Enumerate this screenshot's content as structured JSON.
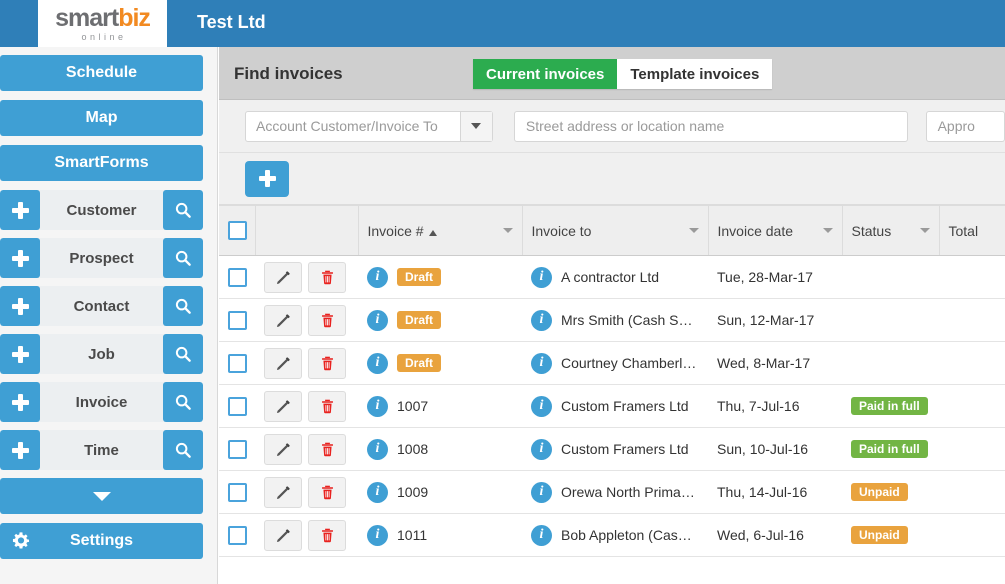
{
  "header": {
    "logo_main_first": "smart",
    "logo_main_second": "biz",
    "logo_sub": "online",
    "company": "Test Ltd"
  },
  "sidebar": {
    "primary": [
      {
        "label": "Schedule"
      },
      {
        "label": "Map"
      },
      {
        "label": "SmartForms"
      }
    ],
    "entities": [
      {
        "label": "Customer"
      },
      {
        "label": "Prospect"
      },
      {
        "label": "Contact"
      },
      {
        "label": "Job"
      },
      {
        "label": "Invoice"
      },
      {
        "label": "Time"
      }
    ],
    "settings_label": "Settings"
  },
  "page": {
    "title": "Find invoices",
    "tabs": [
      {
        "label": "Current invoices",
        "active": true
      },
      {
        "label": "Template invoices",
        "active": false
      }
    ]
  },
  "filters": {
    "customer_select": "Account Customer/Invoice To",
    "address_placeholder": "Street address or location name",
    "third_field": "Appro"
  },
  "toolbar": {
    "add_label": "+"
  },
  "table": {
    "columns": [
      {
        "label": "Invoice #",
        "sorted": "asc"
      },
      {
        "label": "Invoice to"
      },
      {
        "label": "Invoice date"
      },
      {
        "label": "Status"
      },
      {
        "label": "Total"
      }
    ],
    "rows": [
      {
        "invoice": "Draft",
        "invoice_is_badge": true,
        "invoice_to": "A contractor Ltd",
        "date": "Tue, 28-Mar-17",
        "status": "",
        "total": ""
      },
      {
        "invoice": "Draft",
        "invoice_is_badge": true,
        "invoice_to": "Mrs Smith (Cash Sale)",
        "date": "Sun, 12-Mar-17",
        "status": "",
        "total": ""
      },
      {
        "invoice": "Draft",
        "invoice_is_badge": true,
        "invoice_to": "Courtney Chamberlai...",
        "date": "Wed, 8-Mar-17",
        "status": "",
        "total": ""
      },
      {
        "invoice": "1007",
        "invoice_is_badge": false,
        "invoice_to": "Custom Framers Ltd",
        "date": "Thu, 7-Jul-16",
        "status": "Paid in full",
        "status_kind": "paid",
        "total": ""
      },
      {
        "invoice": "1008",
        "invoice_is_badge": false,
        "invoice_to": "Custom Framers Ltd",
        "date": "Sun, 10-Jul-16",
        "status": "Paid in full",
        "status_kind": "paid",
        "total": ""
      },
      {
        "invoice": "1009",
        "invoice_is_badge": false,
        "invoice_to": "Orewa North Primary...",
        "date": "Thu, 14-Jul-16",
        "status": "Unpaid",
        "status_kind": "unpaid",
        "total": ""
      },
      {
        "invoice": "1011",
        "invoice_is_badge": false,
        "invoice_to": "Bob Appleton (Cash ...",
        "date": "Wed, 6-Jul-16",
        "status": "Unpaid",
        "status_kind": "unpaid",
        "total": ""
      }
    ]
  },
  "colors": {
    "header_blue": "#2f7fb8",
    "accent_blue": "#3f9fd4",
    "active_green": "#2cac4f",
    "badge_orange": "#e9a33e",
    "badge_green": "#72b544",
    "logo_orange": "#f28a21"
  }
}
